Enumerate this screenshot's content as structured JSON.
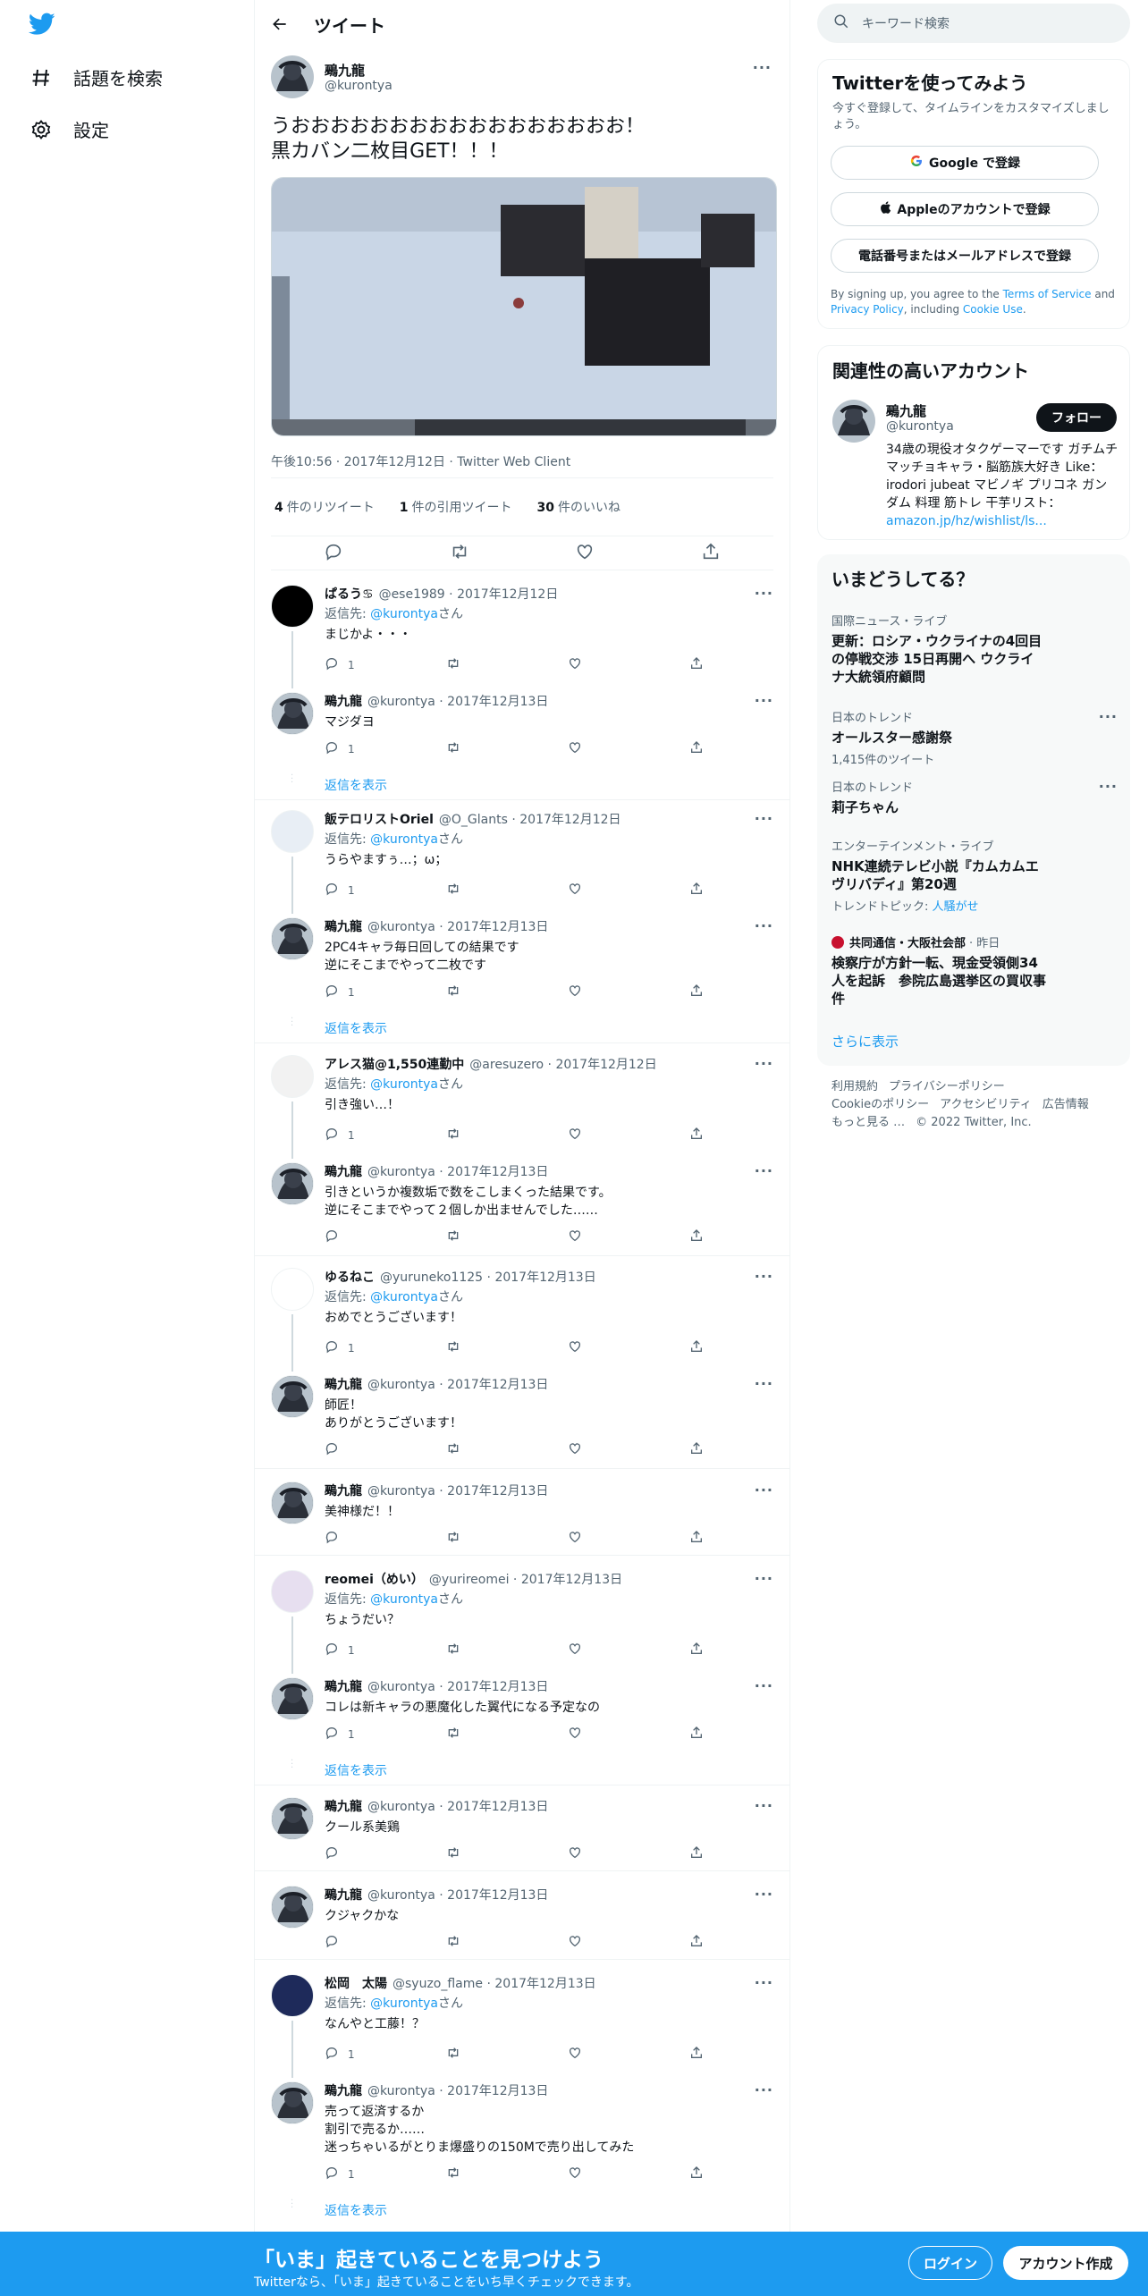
{
  "nav": {
    "explore": "話題を検索",
    "settings": "設定"
  },
  "header": {
    "title": "ツイート"
  },
  "main_tweet": {
    "name": "鵐九龍",
    "handle": "@kurontya",
    "text": "うおおおおおおおおおおおおおおおおお！\n黒カバン二枚目GET！！！",
    "time": "午後10:56 · 2017年12月12日 · Twitter Web Client",
    "retweets": "4",
    "retweets_label": "件のリツイート",
    "quotes": "1",
    "quotes_label": "件の引用ツイート",
    "likes": "30",
    "likes_label": "件のいいね"
  },
  "replies": [
    {
      "name": "ぱるう♋",
      "handle": "@ese1989",
      "date": "2017年12月12日",
      "to_label": "返信先: ",
      "to": "@kurontya",
      "to_suffix": "さん",
      "text": "まじかよ・・・",
      "count": "1"
    },
    {
      "name": "鵐九龍",
      "handle": "@kurontya",
      "date": "2017年12月13日",
      "text": "マジダヨ",
      "count": "1"
    },
    {
      "name": "飯テロリストOriel",
      "handle": "@O_Glants",
      "date": "2017年12月12日",
      "to_label": "返信先: ",
      "to": "@kurontya",
      "to_suffix": "さん",
      "text": "うらやますぅ…；ω；",
      "count": "1"
    },
    {
      "name": "鵐九龍",
      "handle": "@kurontya",
      "date": "2017年12月13日",
      "text": "2PC4キャラ毎日回しての結果です\n逆にそこまでやって二枚です",
      "count": "1"
    },
    {
      "name": "アレス猫@1,550連勤中",
      "handle": "@aresuzero",
      "date": "2017年12月12日",
      "to_label": "返信先: ",
      "to": "@kurontya",
      "to_suffix": "さん",
      "text": "引き強い…！",
      "count": "1"
    },
    {
      "name": "鵐九龍",
      "handle": "@kurontya",
      "date": "2017年12月13日",
      "text": "引きというか複数垢で数をこしまくった結果です。\n逆にそこまでやって２個しか出ませんでした……",
      "count": ""
    },
    {
      "name": "ゆるねこ",
      "handle": "@yuruneko1125",
      "date": "2017年12月13日",
      "to_label": "返信先: ",
      "to": "@kurontya",
      "to_suffix": "さん",
      "text": "おめでとうございます！",
      "count": "1"
    },
    {
      "name": "鵐九龍",
      "handle": "@kurontya",
      "date": "2017年12月13日",
      "text": "師匠！\nありがとうございます！",
      "count": ""
    },
    {
      "name": "鵐九龍",
      "handle": "@kurontya",
      "date": "2017年12月13日",
      "text": "美神様だ！！",
      "count": ""
    },
    {
      "name": "reomei（めい）",
      "handle": "@yurireomei",
      "date": "2017年12月13日",
      "to_label": "返信先: ",
      "to": "@kurontya",
      "to_suffix": "さん",
      "text": "ちょうだい？",
      "count": "1"
    },
    {
      "name": "鵐九龍",
      "handle": "@kurontya",
      "date": "2017年12月13日",
      "text": "コレは新キャラの悪魔化した翼代になる予定なの",
      "count": "1"
    },
    {
      "name": "鵐九龍",
      "handle": "@kurontya",
      "date": "2017年12月13日",
      "text": "クール系美鶏",
      "count": ""
    },
    {
      "name": "鵐九龍",
      "handle": "@kurontya",
      "date": "2017年12月13日",
      "text": "クジャクかな",
      "count": ""
    },
    {
      "name": "松岡　太陽",
      "handle": "@syuzo_flame",
      "date": "2017年12月13日",
      "to_label": "返信先: ",
      "to": "@kurontya",
      "to_suffix": "さん",
      "text": "なんやと工藤！？",
      "count": "1"
    },
    {
      "name": "鵐九龍",
      "handle": "@kurontya",
      "date": "2017年12月13日",
      "text": "売って返済するか\n割引で売るか……\n迷っちゃいるがとりま爆盛りの150Mで売り出してみた",
      "count": "1"
    }
  ],
  "show_replies": "返信を表示",
  "search": {
    "placeholder": "キーワード検索"
  },
  "signup_card": {
    "title": "Twitterを使ってみよう",
    "desc": "今すぐ登録して、タイムラインをカスタマイズしましょう。",
    "google": "Google で登録",
    "apple": "Appleのアカウントで登録",
    "phone": "電話番号またはメールアドレスで登録",
    "terms_pre": "By signing up, you agree to the ",
    "terms": "Terms of Service",
    "and": " and ",
    "privacy": "Privacy Policy",
    "including": ", including ",
    "cookie": "Cookie Use",
    "period": "."
  },
  "related": {
    "title": "関連性の高いアカウント",
    "name": "鵐九龍",
    "handle": "@kurontya",
    "follow": "フォロー",
    "bio": "34歳の現役オタクゲーマーです ガチムチマッチョキャラ・脳筋族大好き Like： irodori jubeat マビノギ プリコネ ガンダム 料理 筋トレ 干芋リスト：",
    "link": "amazon.jp/hz/wishlist/ls..."
  },
  "trends": {
    "title": "いまどうしてる？",
    "items": [
      {
        "cat": "国際ニュース・ライブ",
        "title": "更新：ロシア・ウクライナの4回目の停戦交渉 15日再開へ ウクライナ大統領府顧問"
      },
      {
        "cat": "日本のトレンド",
        "title": "オールスター感謝祭",
        "sub": "1,415件のツイート"
      },
      {
        "cat": "日本のトレンド",
        "title": "莉子ちゃん"
      },
      {
        "cat": "エンターテインメント・ライブ",
        "title": "NHK連続テレビ小説『カムカムエヴリバディ』第20週",
        "sub_label": "トレンドトピック: ",
        "sub_link": "人騒がせ"
      },
      {
        "cat": "共同通信・大阪社会部",
        "time": "· 昨日",
        "title": "検察庁が方針一転、現金受領側34人を起訴　参院広島選挙区の買収事件"
      }
    ],
    "more": "さらに表示"
  },
  "footer": {
    "l1a": "利用規約",
    "l1b": "プライバシーポリシー",
    "l2a": "Cookieのポリシー",
    "l2b": "アクセシビリティ",
    "l2c": "広告情報",
    "l3a": "もっと見る …",
    "l3b": "© 2022 Twitter, Inc."
  },
  "bottom": {
    "headline": "「いま」起きていることを見つけよう",
    "sub": "Twitterなら、「いま」起きていることをいち早くチェックできます。",
    "login": "ログイン",
    "signup": "アカウント作成"
  },
  "colors": {
    "accent": "#1d9bf0",
    "text": "#0f1419",
    "muted": "#536471"
  }
}
